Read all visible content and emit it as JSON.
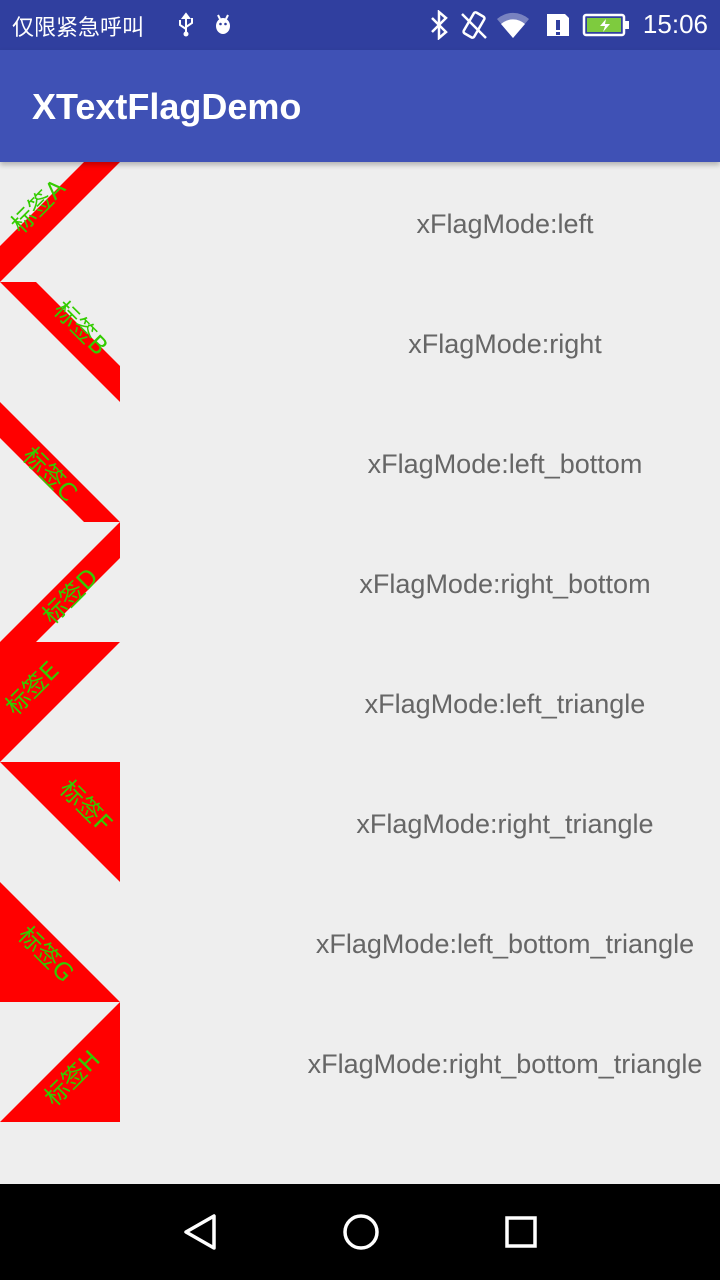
{
  "status_bar": {
    "carrier": "仅限紧急呼叫",
    "time": "15:06",
    "icons": [
      "usb-icon",
      "android-debug-icon",
      "bluetooth-icon",
      "vibrate-icon",
      "wifi-icon",
      "sim-alert-icon",
      "battery-charging-icon"
    ]
  },
  "app_bar": {
    "title": "XTextFlagDemo"
  },
  "flag_colors": {
    "fill": "#ff0000",
    "text": "#33cc00"
  },
  "items": [
    {
      "flag_text": "标签A",
      "mode": "xFlagMode:left"
    },
    {
      "flag_text": "标签B",
      "mode": "xFlagMode:right"
    },
    {
      "flag_text": "标签C",
      "mode": "xFlagMode:left_bottom"
    },
    {
      "flag_text": "标签D",
      "mode": "xFlagMode:right_bottom"
    },
    {
      "flag_text": "标签E",
      "mode": "xFlagMode:left_triangle"
    },
    {
      "flag_text": "标签F",
      "mode": "xFlagMode:right_triangle"
    },
    {
      "flag_text": "标签G",
      "mode": "xFlagMode:left_bottom_triangle"
    },
    {
      "flag_text": "标签H",
      "mode": "xFlagMode:right_bottom_triangle"
    }
  ],
  "nav_bar": {
    "icons": [
      "back-icon",
      "home-icon",
      "recents-icon"
    ]
  }
}
